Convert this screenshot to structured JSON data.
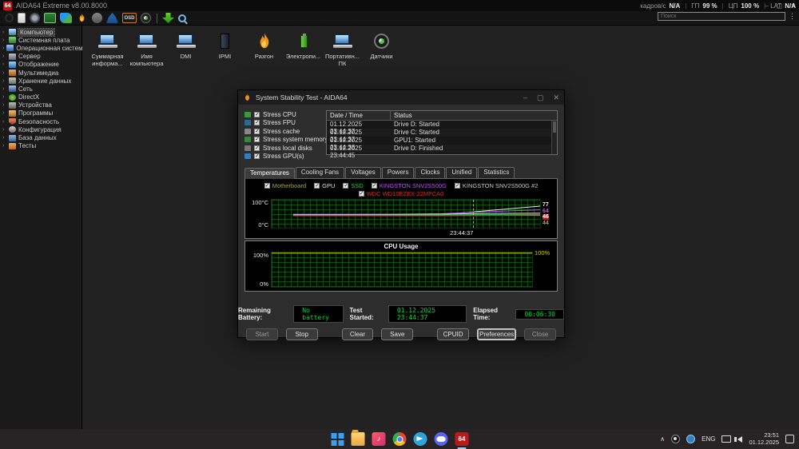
{
  "app": {
    "title": "AIDA64 Extreme v8.00.8000",
    "logo_text": "64"
  },
  "window_controls": {
    "minimize": "–",
    "maximize": "▢",
    "close": "✕"
  },
  "toolbar": {
    "osd_label": "OSD",
    "search_placeholder": "Поиск",
    "status": {
      "fps_label": "кадров/с",
      "fps_value": "N/A",
      "gpu_label": "ГП",
      "gpu_value": "99 %",
      "cpu_label": "ЦП",
      "cpu_value": "100 %",
      "lat_label": "LAT",
      "lat_value": "N/A"
    }
  },
  "sidebar": {
    "items": [
      {
        "label": "Компьютер"
      },
      {
        "label": "Системная плата"
      },
      {
        "label": "Операционная система"
      },
      {
        "label": "Сервер"
      },
      {
        "label": "Отображение"
      },
      {
        "label": "Мультимедиа"
      },
      {
        "label": "Хранение данных"
      },
      {
        "label": "Сеть"
      },
      {
        "label": "DirectX"
      },
      {
        "label": "Устройства"
      },
      {
        "label": "Программы"
      },
      {
        "label": "Безопасность"
      },
      {
        "label": "Конфигурация"
      },
      {
        "label": "База данных"
      },
      {
        "label": "Тесты"
      }
    ]
  },
  "quick_icons": [
    {
      "label": "Суммарная информа..."
    },
    {
      "label": "Имя компьютера"
    },
    {
      "label": "DMI"
    },
    {
      "label": "IPMI"
    },
    {
      "label": "Разгон"
    },
    {
      "label": "Электропи..."
    },
    {
      "label": "Портативн... ПК"
    },
    {
      "label": "Датчики"
    }
  ],
  "sst": {
    "title": "System Stability Test - AIDA64",
    "checkboxes": [
      {
        "label": "Stress CPU"
      },
      {
        "label": "Stress FPU"
      },
      {
        "label": "Stress cache"
      },
      {
        "label": "Stress system memory"
      },
      {
        "label": "Stress local disks"
      },
      {
        "label": "Stress GPU(s)"
      }
    ],
    "log": {
      "headers": [
        "Date / Time",
        "Status"
      ],
      "rows": [
        [
          "01.12.2025 23:44:37",
          "Drive D: Started"
        ],
        [
          "01.12.2025 23:44:37",
          "Drive C: Started"
        ],
        [
          "01.12.2025 23:44:38",
          "GPU1: Started"
        ],
        [
          "01.12.2025 23:44:45",
          "Drive D: Finished"
        ]
      ]
    },
    "tabs": [
      "Temperatures",
      "Cooling Fans",
      "Voltages",
      "Powers",
      "Clocks",
      "Unified",
      "Statistics"
    ],
    "active_tab": "Temperatures",
    "info": {
      "battery_label": "Remaining Battery:",
      "battery_value": "No battery",
      "started_label": "Test Started:",
      "started_value": "01.12.2025 23:44:37",
      "elapsed_label": "Elapsed Time:",
      "elapsed_value": "00:06:30"
    },
    "buttons": {
      "start": "Start",
      "stop": "Stop",
      "clear": "Clear",
      "save": "Save",
      "cpuid": "CPUID",
      "preferences": "Preferences",
      "close": "Close"
    }
  },
  "chart_data": [
    {
      "type": "line",
      "title": "Temperatures",
      "ylabel": "°C",
      "ylim": [
        0,
        100
      ],
      "ytop_label": "100°C",
      "ybottom_label": "0°C",
      "time_label": "23:44:37",
      "grid": true,
      "legend_position": "top",
      "series": [
        {
          "name": "Motherboard",
          "color": "#a8a832",
          "values": [
            44,
            44,
            44,
            44,
            44,
            44
          ]
        },
        {
          "name": "GPU",
          "color": "#e8e8e8",
          "values": [
            45,
            45,
            45,
            46,
            62,
            77
          ]
        },
        {
          "name": "SSD",
          "color": "#33bb55",
          "values": [
            46,
            46,
            46,
            46,
            47,
            48
          ]
        },
        {
          "name": "KINGSTON SNV2S500G",
          "color": "#bb55ee",
          "values": [
            47,
            47,
            48,
            50,
            58,
            64
          ]
        },
        {
          "name": "KINGSTON SNV2S500G #2",
          "color": "#cccccc",
          "values": [
            48,
            48,
            48,
            49,
            51,
            52
          ]
        },
        {
          "name": "WDC WD10EZEX-22MFCA0",
          "color": "#cc3333",
          "values": [
            43,
            43,
            43,
            43,
            44,
            46
          ]
        }
      ],
      "end_labels": [
        {
          "text": "77",
          "color": "#e8e8e8",
          "bg": "transparent"
        },
        {
          "text": "64",
          "color": "#bb55ee",
          "bg": "transparent"
        },
        {
          "text": "46",
          "color": "#ffffff",
          "bg": "#aa2222"
        },
        {
          "text": "44",
          "color": "#a8a832",
          "bg": "transparent"
        }
      ]
    },
    {
      "type": "line",
      "title": "CPU Usage",
      "ylim": [
        0,
        100
      ],
      "ytop_label": "100%",
      "ybottom_label": "0%",
      "right_label": "100%",
      "grid": true,
      "series": [
        {
          "name": "CPU Usage",
          "color": "#cccc00",
          "values": [
            100,
            100,
            100,
            100,
            100,
            100
          ]
        }
      ]
    }
  ],
  "taskbar": {
    "tray": {
      "chevron": "∧",
      "lang": "ENG",
      "time": "23:51",
      "date": "01.12.2025"
    }
  }
}
